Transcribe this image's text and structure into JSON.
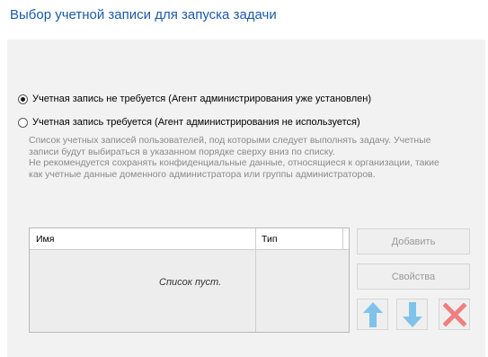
{
  "title": "Выбор учетной записи для запуска задачи",
  "options": {
    "no_account": {
      "label": "Учетная запись не требуется (Агент администрирования уже установлен)",
      "selected": true
    },
    "account_required": {
      "label": "Учетная запись требуется (Агент администрирования не используется)",
      "selected": false,
      "description": [
        "Список учетных записей пользователей, под которыми следует выполнять задачу. Учетные",
        "записи будут выбираться в указанном порядке сверху вниз по списку.",
        "Не рекомендуется сохранять конфиденциальные данные, относящиеся к организации, такие",
        "как учетные данные доменного администратора или группы администраторов."
      ]
    }
  },
  "accounts_table": {
    "columns": [
      "Имя",
      "Тип"
    ],
    "rows": [],
    "empty_text": "Список пуст."
  },
  "buttons": {
    "add": "Добавить",
    "properties": "Свойства",
    "move_up_icon": "arrow-up-icon",
    "move_down_icon": "arrow-down-icon",
    "delete_icon": "delete-x-icon"
  },
  "colors": {
    "title": "#1b5aa7",
    "arrow": "#7fc3ea",
    "delete": "#f07f7f",
    "disabled_text": "#9a9a9a"
  }
}
